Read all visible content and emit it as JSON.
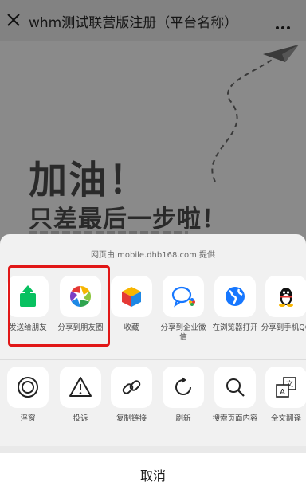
{
  "window": {
    "title": "whm测试联营版注册（平台名称）"
  },
  "background": {
    "headline_1": "加油！",
    "headline_2": "只差最后一步啦！"
  },
  "sheet": {
    "provider": "网页由 mobile.dhb168.com 提供",
    "row1": [
      {
        "label": "发送给朋友",
        "icon": "share-arrow-icon"
      },
      {
        "label": "分享到朋友圈",
        "icon": "moments-icon"
      },
      {
        "label": "收藏",
        "icon": "favorite-cube-icon"
      },
      {
        "label": "分享到企业微信",
        "icon": "work-wechat-icon"
      },
      {
        "label": "在浏览器打开",
        "icon": "globe-icon"
      },
      {
        "label": "分享到手机QQ",
        "icon": "qq-penguin-icon"
      }
    ],
    "row2": [
      {
        "label": "浮窗",
        "icon": "float-window-icon"
      },
      {
        "label": "投诉",
        "icon": "warning-icon"
      },
      {
        "label": "复制链接",
        "icon": "link-icon"
      },
      {
        "label": "刷新",
        "icon": "refresh-icon"
      },
      {
        "label": "搜索页面内容",
        "icon": "search-icon"
      },
      {
        "label": "全文翻译",
        "icon": "translate-icon"
      }
    ],
    "cancel": "取消"
  },
  "colors": {
    "highlight": "#e11717",
    "share_green": "#07c160",
    "globe_blue": "#1677ff"
  }
}
